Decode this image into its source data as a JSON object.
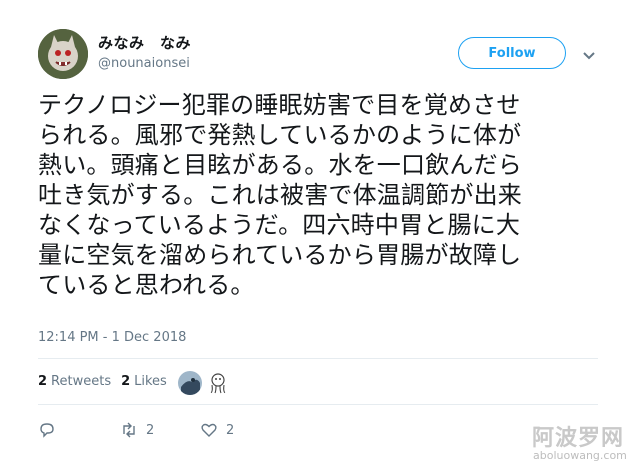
{
  "user": {
    "display_name": "みなみ　なみ",
    "handle": "@nounaionsei"
  },
  "follow_label": "Follow",
  "tweet": {
    "lines": [
      "テクノロジー犯罪の睡眠妨害で目を覚めさせ",
      "られる。風邪で発熱しているかのように体が",
      "熱い。頭痛と目眩がある。水を一口飲んだら",
      "吐き気がする。これは被害で体温調節が出来",
      "なくなっているようだ。四六時中胃と腸に大",
      "量に空気を溜められているから胃腸が故障し",
      "ていると思われる。"
    ],
    "timestamp": "12:14 PM - 1 Dec 2018"
  },
  "stats": {
    "retweets_count": "2",
    "retweets_label": "Retweets",
    "likes_count": "2",
    "likes_label": "Likes"
  },
  "actions": {
    "reply_icon": "reply-icon",
    "retweet_count": "2",
    "like_count": "2"
  },
  "watermark": {
    "chinese": "阿波罗网",
    "url": "aboluowang.com"
  },
  "colors": {
    "accent": "#1da1f2",
    "muted": "#657786",
    "text": "#14171a"
  }
}
